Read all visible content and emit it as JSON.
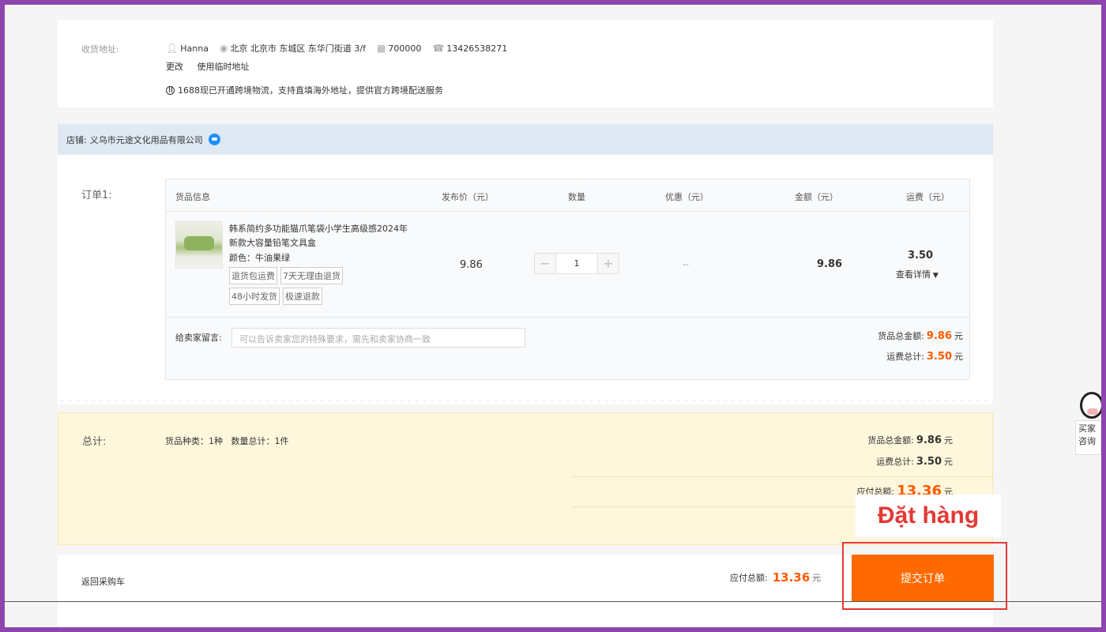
{
  "address": {
    "label": "收货地址:",
    "name": "Hanna",
    "location": "北京 北京市 东城区 东华门街道 3/f",
    "postcode": "700000",
    "phone": "13426538271",
    "change_label": "更改",
    "temp_label": "使用临时地址",
    "crossborder_note": "1688现已开通跨境物流，支持直填海外地址，提供官方跨境配送服务"
  },
  "shop": {
    "label": "店铺:",
    "name": "义乌市元途文化用品有限公司"
  },
  "order": {
    "label": "订单1:",
    "headers": [
      "货品信息",
      "发布价（元）",
      "数量",
      "优惠（元）",
      "金额（元）",
      "运费（元）"
    ],
    "product": {
      "name": "韩系简约多功能猫爪笔袋小学生高级感2024年新款大容量铅笔文具盒",
      "spec": "颜色：牛油果绿",
      "tags": [
        "退货包运费",
        "7天无理由退货",
        "48小时发货",
        "极速退款"
      ],
      "price": "9.86",
      "qty": "1",
      "discount": "--",
      "amount": "9.86",
      "shipping": "3.50",
      "detail_label": "查看详情"
    },
    "message_label": "给卖家留言:",
    "message_placeholder": "可以告诉卖家您的特殊要求，需先和卖家协商一致",
    "goods_total_label": "货品总金额:",
    "goods_total": "9.86",
    "shipping_total_label": "运费总计:",
    "shipping_total": "3.50",
    "unit": "元"
  },
  "total": {
    "label": "总计:",
    "kinds": "货品种类：1种   数量总计：1件",
    "goods_total_label": "货品总金额:",
    "goods_total": "9.86",
    "shipping_total_label": "运费总计:",
    "shipping_total": "3.50",
    "payable_label": "应付总额:",
    "payable": "13.36",
    "unit": "元"
  },
  "footer": {
    "back_label": "返回采购车",
    "payable_label": "应付总额:",
    "payable": "13.36",
    "unit": "元",
    "submit_label": "提交订单"
  },
  "callout": "Đặt hàng",
  "mascot": {
    "line1": "买家",
    "line2": "咨询"
  },
  "colors": {
    "accent": "#ff6a00",
    "highlight": "#e53935",
    "frame": "#8e44ad"
  }
}
